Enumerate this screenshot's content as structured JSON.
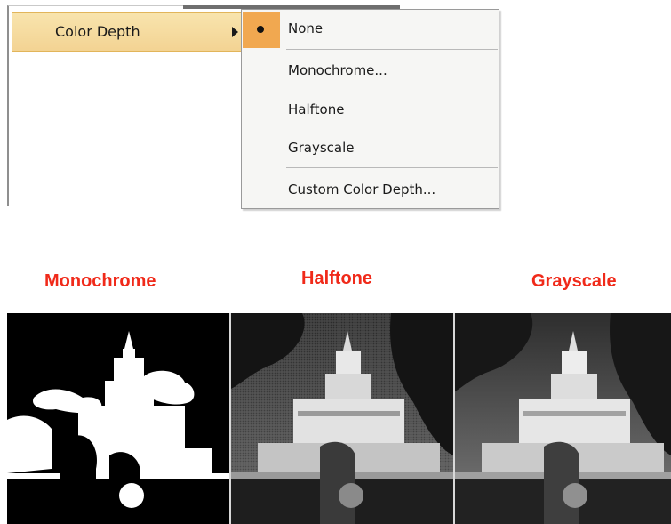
{
  "parent_menu": {
    "item_label": "Color Depth",
    "submenu_arrow_icon": "chevron-right-icon"
  },
  "submenu": {
    "items": [
      {
        "label": "None",
        "checked": true
      },
      {
        "label": "Monochrome...",
        "checked": false
      },
      {
        "label": "Halftone",
        "checked": false
      },
      {
        "label": "Grayscale",
        "checked": false
      },
      {
        "label": "Custom Color Depth...",
        "checked": false
      }
    ]
  },
  "captions": {
    "monochrome": "Monochrome",
    "halftone": "Halftone",
    "grayscale": "Grayscale"
  },
  "colors": {
    "caption_red": "#f02a1a",
    "highlight": "#f3d393",
    "check_orange": "#f1a850"
  }
}
